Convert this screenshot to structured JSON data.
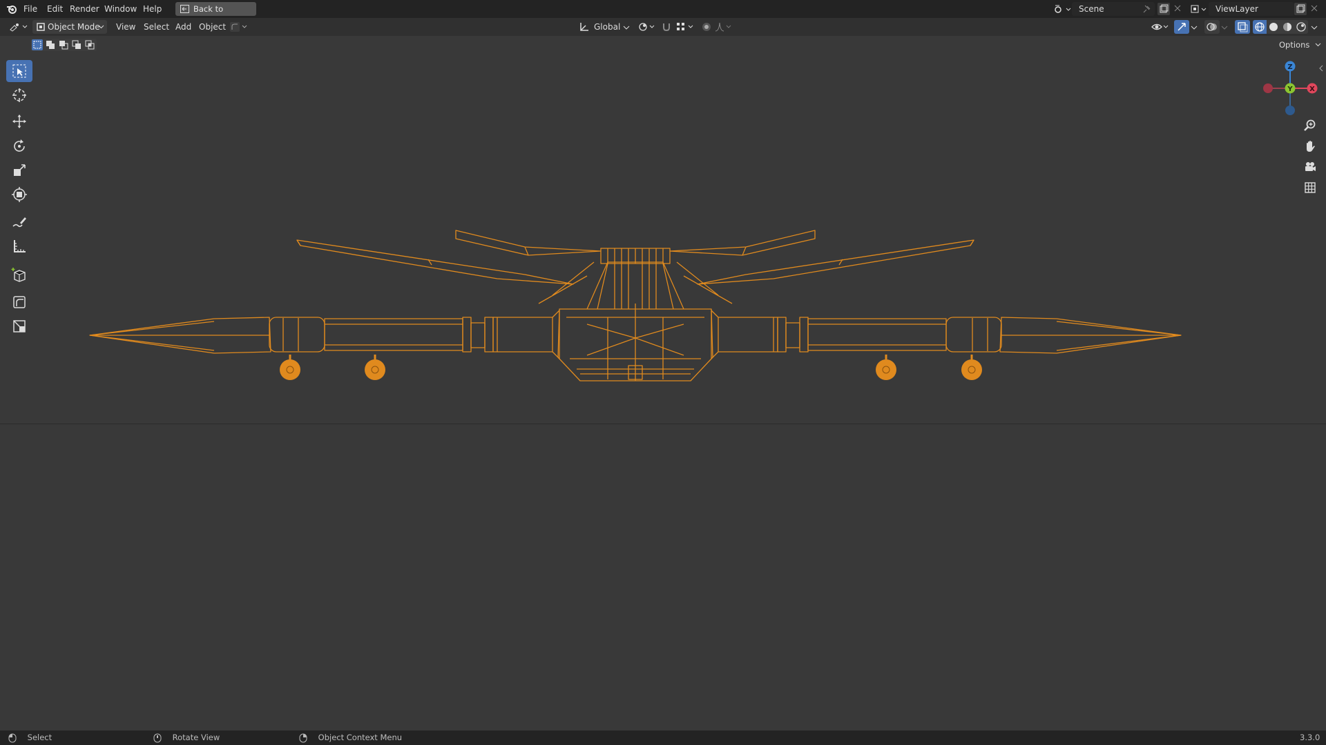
{
  "menu": {
    "items": [
      "File",
      "Edit",
      "Render",
      "Window",
      "Help"
    ],
    "back_button": "Back to Previous"
  },
  "scene": {
    "label": "Scene",
    "view_layer": "ViewLayer"
  },
  "header": {
    "mode": "Object Mode",
    "menus": [
      "View",
      "Select",
      "Add",
      "Object"
    ],
    "transform_orientation": "Global",
    "options": "Options"
  },
  "toolbar": {
    "tools": [
      "select-box",
      "cursor",
      "move",
      "rotate",
      "scale",
      "transform",
      "annotate",
      "measure",
      "add-cube",
      "shear",
      "transform-cage"
    ]
  },
  "gizmo": {
    "z": "Z",
    "y": "Y",
    "x": "X"
  },
  "status": {
    "select": "Select",
    "rotate_view": "Rotate View",
    "context_menu": "Object Context Menu",
    "version": "3.3.0"
  },
  "colors": {
    "accent": "#4772b3",
    "wire": "#e08a1e",
    "axis_x": "#e0475c",
    "axis_y": "#8bc531",
    "axis_z": "#3a86d6"
  }
}
